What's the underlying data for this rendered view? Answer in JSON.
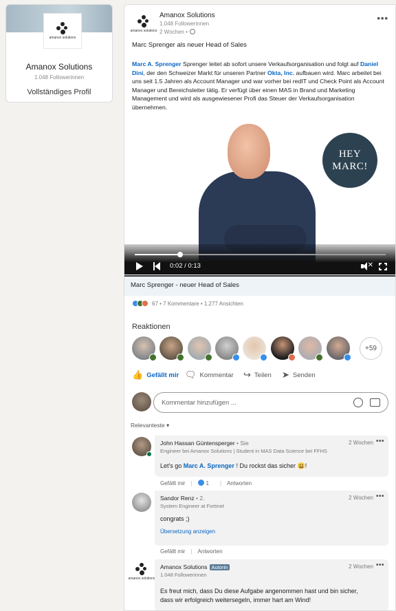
{
  "left_card": {
    "logo_text": "amanox solutions",
    "name": "Amanox Solutions",
    "followers": "1.048 Followerinnen",
    "profile_link": "Vollständiges Profil"
  },
  "post": {
    "author": "Amanox Solutions",
    "logo_text": "amanox solutions",
    "followers": "1.048 Followerinnen",
    "time": "2 Wochen •",
    "more": "•••",
    "title": "Marc Sprenger als neuer Head of Sales",
    "body": {
      "mention_1": "Marc A. Sprenger",
      "text_1": " Sprenger leitet ab sofort unsere Verkaufsorganisation und folgt auf ",
      "mention_2": "Daniel Dini",
      "text_2": ", der den Schweizer Markt für unseren Partner ",
      "mention_3": "Okta, Inc.",
      "text_3": " aufbauen wird. Marc arbeitet bei uns seit 1.5 Jahren als Account Manager und war vorher bei redIT und Check Point als Account Manager und Bereichsleiter tätig. Er verfügt über einen MAS in Brand und Marketing Management und wird als ausgewiesener Profi das Steuer der Verkaufsorganisation übernehmen."
    }
  },
  "video": {
    "hey_line1": "HEY",
    "hey_line2": "MARC!",
    "time": "0:02 / 0:13",
    "progress_fraction": 0.18,
    "caption": "Marc Sprenger - neuer Head of Sales"
  },
  "social": {
    "counts": "67 • 7 Kommentare • 1.277 Ansichten",
    "reactions_title": "Reaktionen",
    "more_reactors": "+59"
  },
  "actions": {
    "like": "Gefällt mir",
    "comment": "Kommentar",
    "share": "Teilen",
    "send": "Senden"
  },
  "composer": {
    "placeholder": "Kommentar hinzufügen ..."
  },
  "sort": {
    "label": "Relevanteste ▾"
  },
  "comments": [
    {
      "name": "John Hassan Güntensperger",
      "degree": " • Sie",
      "headline": "Engineer bei Amanox Solutions | Student in MAS Data Science bei FFHS",
      "time": "2 Wochen",
      "text_before": "Let's go ",
      "mention": "Marc A. Sprenger",
      "text_after": " ! Du rockst das sicher 😃!",
      "like_label": "Gefällt mir",
      "like_count": "1",
      "reply_label": "Antworten"
    },
    {
      "name": "Sandor Renz",
      "degree": " • 2.",
      "headline": "System Engineer at Fortinet",
      "time": "2 Wochen",
      "text": "congrats ;)",
      "translate": "Übersetzung anzeigen",
      "like_label": "Gefällt mir",
      "reply_label": "Antworten"
    },
    {
      "name": "Amanox Solutions",
      "badge": "Autorin",
      "headline": "1.048 Followerinnen",
      "logo_text": "amanox solutions",
      "time": "2 Wochen",
      "text_line1": "Es freut mich, dass Du diese Aufgabe angenommen hast und bin sicher,",
      "text_line2": "dass wir erfolgreich weitersegeln, immer hart am Wind!"
    }
  ],
  "colors": {
    "link_blue": "#0a66c2",
    "hey_circle": "#2d4251",
    "online_green": "#057642"
  }
}
